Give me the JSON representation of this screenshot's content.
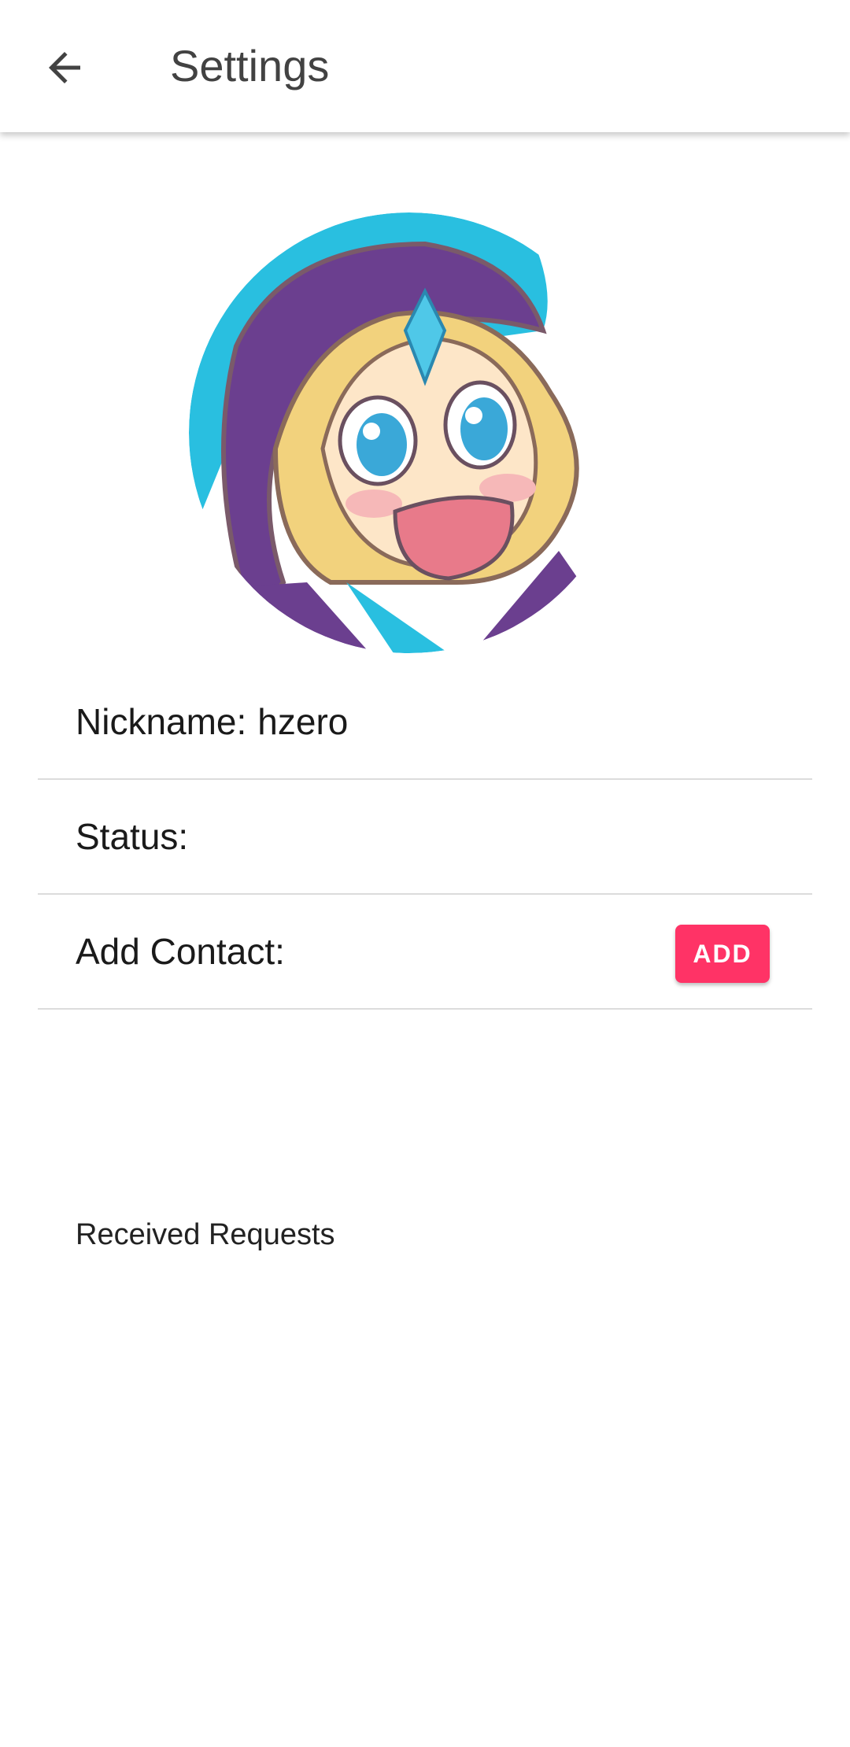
{
  "app_bar": {
    "title": "Settings",
    "back_icon": "arrow-back-icon"
  },
  "profile": {
    "avatar_icon": "anime-character-avatar",
    "nickname_label": "Nickname:",
    "nickname_value": "hzero",
    "status_label": "Status:",
    "status_value": "",
    "add_contact_label": "Add Contact:",
    "add_button_label": "ADD"
  },
  "requests": {
    "heading": "Received Requests"
  },
  "colors": {
    "accent": "#ff3366",
    "title_text": "#424242",
    "divider": "#dcdcdc"
  }
}
